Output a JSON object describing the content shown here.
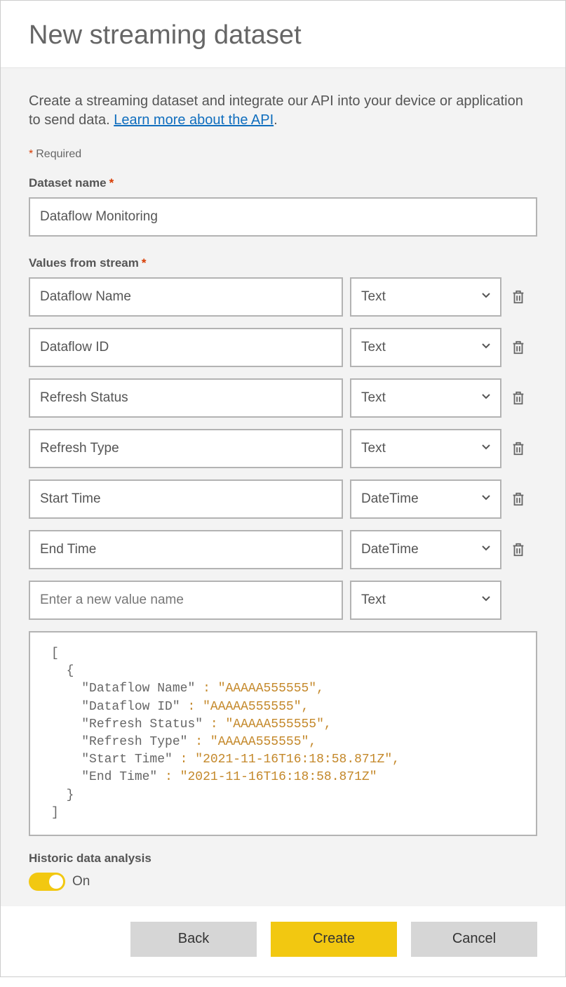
{
  "title": "New streaming dataset",
  "intro_text": "Create a streaming dataset and integrate our API into your device or application to send data. ",
  "learn_more": "Learn more about the API",
  "required_hint": "Required",
  "dataset_name_label": "Dataset name",
  "dataset_name_value": "Dataflow Monitoring",
  "values_label": "Values from stream",
  "rows": [
    {
      "name": "Dataflow Name",
      "type": "Text"
    },
    {
      "name": "Dataflow ID",
      "type": "Text"
    },
    {
      "name": "Refresh Status",
      "type": "Text"
    },
    {
      "name": "Refresh Type",
      "type": "Text"
    },
    {
      "name": "Start Time",
      "type": "DateTime"
    },
    {
      "name": "End Time",
      "type": "DateTime"
    }
  ],
  "new_row": {
    "placeholder": "Enter a new value name",
    "type": "Text"
  },
  "json_lines": [
    {
      "text": "[",
      "indent": 0,
      "cls": ""
    },
    {
      "text": "{",
      "indent": 1,
      "cls": ""
    },
    {
      "key": "\"Dataflow Name\"",
      "val": "\"AAAAA555555\"",
      "indent": 2,
      "comma": true
    },
    {
      "key": "\"Dataflow ID\"",
      "val": "\"AAAAA555555\"",
      "indent": 2,
      "comma": true
    },
    {
      "key": "\"Refresh Status\"",
      "val": "\"AAAAA555555\"",
      "indent": 2,
      "comma": true
    },
    {
      "key": "\"Refresh Type\"",
      "val": "\"AAAAA555555\"",
      "indent": 2,
      "comma": true
    },
    {
      "key": "\"Start Time\"",
      "val": "\"2021-11-16T16:18:58.871Z\"",
      "indent": 2,
      "comma": true
    },
    {
      "key": "\"End Time\"",
      "val": "\"2021-11-16T16:18:58.871Z\"",
      "indent": 2,
      "comma": false
    },
    {
      "text": "}",
      "indent": 1,
      "cls": ""
    },
    {
      "text": "]",
      "indent": 0,
      "cls": ""
    }
  ],
  "historic_label": "Historic data analysis",
  "historic_state": "On",
  "buttons": {
    "back": "Back",
    "create": "Create",
    "cancel": "Cancel"
  }
}
